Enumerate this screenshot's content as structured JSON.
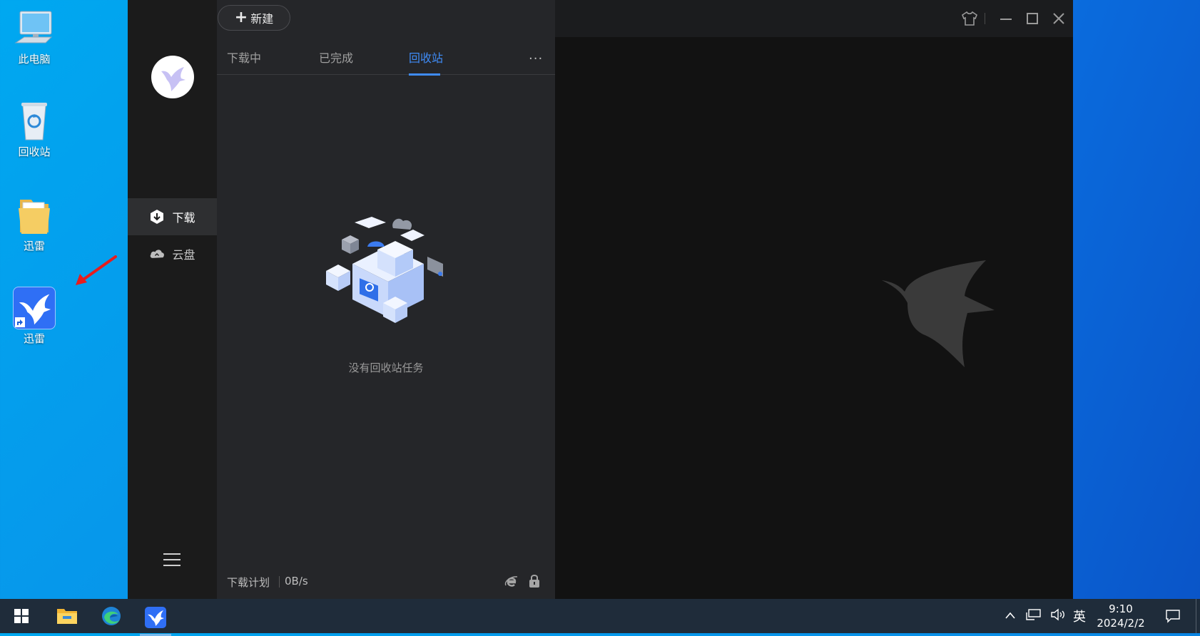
{
  "desktop": {
    "icons": [
      {
        "label": "此电脑"
      },
      {
        "label": "回收站"
      },
      {
        "label": "迅雷"
      },
      {
        "label": "迅雷"
      }
    ]
  },
  "app": {
    "toolbar": {
      "new_label": "新建"
    },
    "sidebar": {
      "items": [
        {
          "label": "下载",
          "active": true
        },
        {
          "label": "云盘",
          "active": false
        }
      ]
    },
    "tabs": [
      {
        "label": "下载中",
        "active": false
      },
      {
        "label": "已完成",
        "active": false
      },
      {
        "label": "回收站",
        "active": true
      }
    ],
    "more_label": "···",
    "empty_message": "没有回收站任务",
    "status": {
      "plan_label": "下载计划",
      "speed": "0B/s"
    },
    "colors": {
      "accent": "#3f8cf7",
      "panel": "#252629",
      "sidebar": "#1b1b1b",
      "main": "#121212"
    }
  },
  "taskbar": {
    "ime": "英",
    "time": "9:10",
    "date": "2024/2/2"
  }
}
